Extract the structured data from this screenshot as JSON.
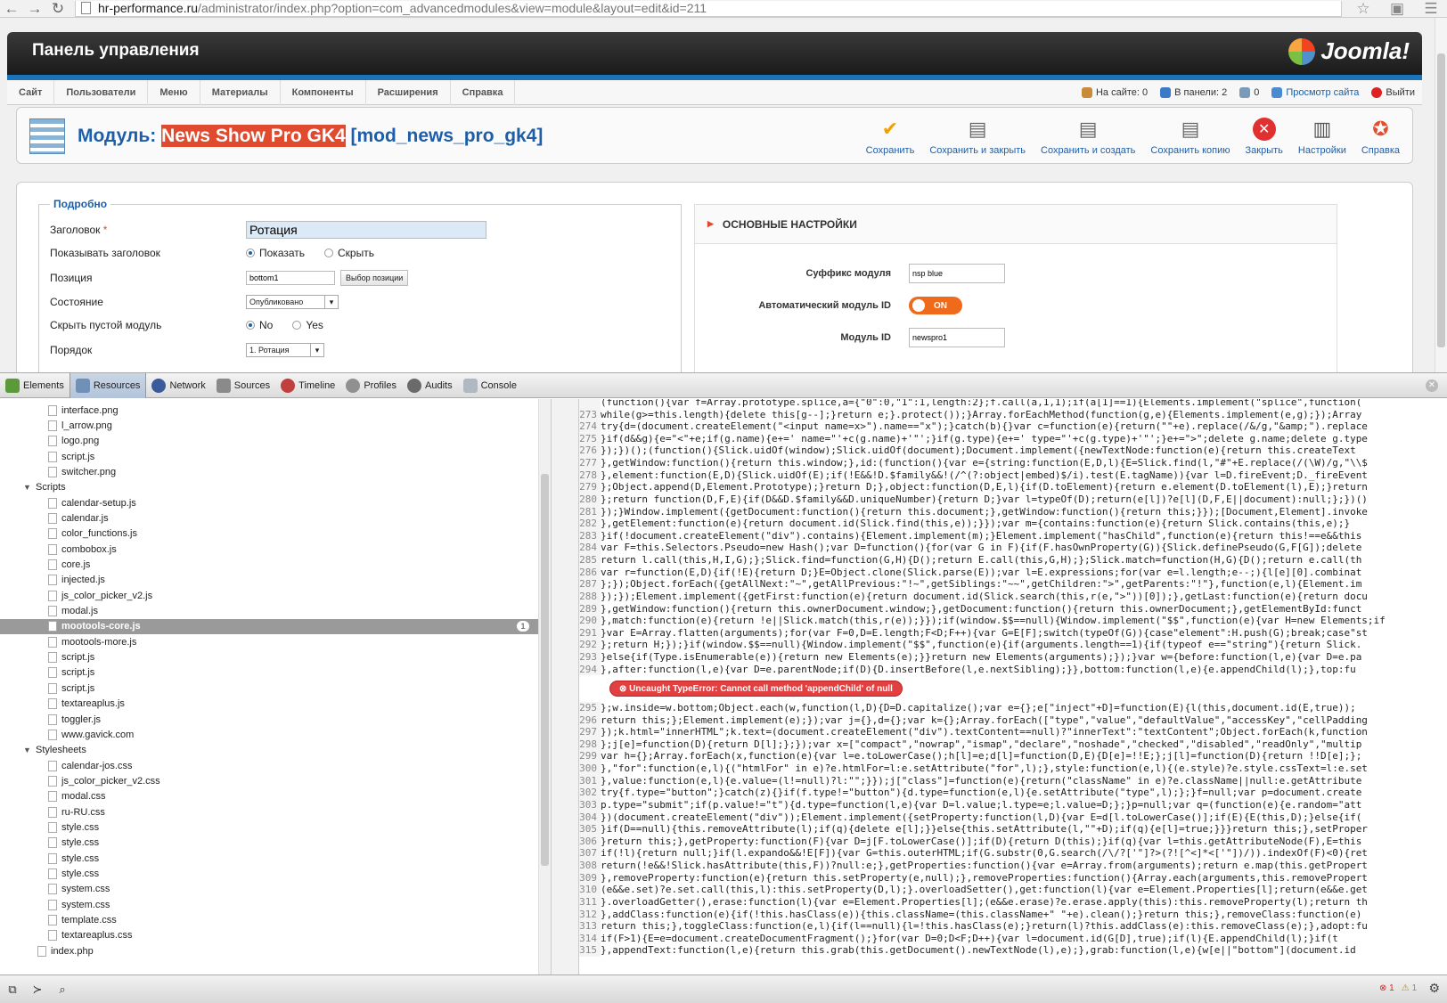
{
  "browser": {
    "url_host": "hr-performance.ru",
    "url_path": "/administrator/index.php?option=com_advancedmodules&view=module&layout=edit&id=211"
  },
  "header": {
    "title": "Панель управления",
    "logo_text": "Joomla!"
  },
  "menu": [
    "Сайт",
    "Пользователи",
    "Меню",
    "Материалы",
    "Компоненты",
    "Расширения",
    "Справка"
  ],
  "status": {
    "online": "На сайте: 0",
    "admins": "В панели: 2",
    "messages": "0",
    "view_site": "Просмотр сайта",
    "logout": "Выйти"
  },
  "page_title": {
    "prefix": "Модуль: ",
    "name": "News Show Pro GK4",
    "suffix": " [mod_news_pro_gk4]"
  },
  "toolbar": [
    "Сохранить",
    "Сохранить и закрыть",
    "Сохранить и создать",
    "Сохранить копию",
    "Закрыть",
    "Настройки",
    "Справка"
  ],
  "form": {
    "legend": "Подробно",
    "title_label": "Заголовок",
    "title_required": "*",
    "title_value": "Ротация",
    "show_title_label": "Показывать заголовок",
    "show": "Показать",
    "hide": "Скрыть",
    "position_label": "Позиция",
    "position_value": "bottom1",
    "position_btn": "Выбор позиции",
    "state_label": "Состояние",
    "state_value": "Опубликовано",
    "hide_empty_label": "Скрыть пустой модуль",
    "no": "No",
    "yes": "Yes",
    "order_label": "Порядок",
    "order_value": "1. Ротация"
  },
  "right": {
    "section": "ОСНОВНЫЕ НАСТРОЙКИ",
    "suffix_label": "Суффикс модуля",
    "suffix_value": "nsp blue",
    "auto_id_label": "Автоматический модуль ID",
    "toggle": "ON",
    "modid_label": "Модуль ID",
    "modid_value": "newspro1"
  },
  "devtools": {
    "tabs": [
      "Elements",
      "Resources",
      "Network",
      "Sources",
      "Timeline",
      "Profiles",
      "Audits",
      "Console"
    ],
    "tree": [
      {
        "t": "file",
        "n": "interface.png",
        "d": 1
      },
      {
        "t": "file",
        "n": "l_arrow.png",
        "d": 1
      },
      {
        "t": "file",
        "n": "logo.png",
        "d": 1
      },
      {
        "t": "file",
        "n": "script.js",
        "d": 1
      },
      {
        "t": "file",
        "n": "switcher.png",
        "d": 1
      },
      {
        "t": "folder",
        "n": "Scripts",
        "d": 0
      },
      {
        "t": "file",
        "n": "calendar-setup.js",
        "d": 1
      },
      {
        "t": "file",
        "n": "calendar.js",
        "d": 1
      },
      {
        "t": "file",
        "n": "color_functions.js",
        "d": 1
      },
      {
        "t": "file",
        "n": "combobox.js",
        "d": 1
      },
      {
        "t": "file",
        "n": "core.js",
        "d": 1
      },
      {
        "t": "file",
        "n": "injected.js",
        "d": 1
      },
      {
        "t": "file",
        "n": "js_color_picker_v2.js",
        "d": 1
      },
      {
        "t": "file",
        "n": "modal.js",
        "d": 1
      },
      {
        "t": "file",
        "n": "mootools-core.js",
        "d": 1,
        "sel": true,
        "badge": "1"
      },
      {
        "t": "file",
        "n": "mootools-more.js",
        "d": 1
      },
      {
        "t": "file",
        "n": "script.js",
        "d": 1
      },
      {
        "t": "file",
        "n": "script.js",
        "d": 1
      },
      {
        "t": "file",
        "n": "script.js",
        "d": 1
      },
      {
        "t": "file",
        "n": "textareaplus.js",
        "d": 1
      },
      {
        "t": "file",
        "n": "toggler.js",
        "d": 1
      },
      {
        "t": "file",
        "n": "www.gavick.com",
        "d": 1
      },
      {
        "t": "folder",
        "n": "Stylesheets",
        "d": 0
      },
      {
        "t": "file",
        "n": "calendar-jos.css",
        "d": 1
      },
      {
        "t": "file",
        "n": "js_color_picker_v2.css",
        "d": 1
      },
      {
        "t": "file",
        "n": "modal.css",
        "d": 1
      },
      {
        "t": "file",
        "n": "ru-RU.css",
        "d": 1
      },
      {
        "t": "file",
        "n": "style.css",
        "d": 1
      },
      {
        "t": "file",
        "n": "style.css",
        "d": 1
      },
      {
        "t": "file",
        "n": "style.css",
        "d": 1
      },
      {
        "t": "file",
        "n": "style.css",
        "d": 1
      },
      {
        "t": "file",
        "n": "system.css",
        "d": 1
      },
      {
        "t": "file",
        "n": "system.css",
        "d": 1
      },
      {
        "t": "file",
        "n": "template.css",
        "d": 1
      },
      {
        "t": "file",
        "n": "textareaplus.css",
        "d": 1
      },
      {
        "t": "file",
        "n": "index.php",
        "d": 0
      }
    ],
    "error": "Uncaught TypeError: Cannot call method 'appendChild' of null",
    "code_top": [
      [
        "",
        "(function(){var f=Array.prototype.splice,a={\"0\":0,\"1\":1,length:2};f.call(a,1,1);if(a[1]==1){Elements.implement(\"splice\",function("
      ],
      [
        "273",
        "while(g>=this.length){delete this[g--];}return e;}.protect());}Array.forEachMethod(function(g,e){Elements.implement(e,g);});Array"
      ],
      [
        "274",
        "try{d=(document.createElement(\"<input name=x>\").name==\"x\");}catch(b){}var c=function(e){return(\"\"+e).replace(/&/g,\"&amp;\").replace"
      ],
      [
        "275",
        "}if(d&&g){e=\"<\"+e;if(g.name){e+=' name=\"'+c(g.name)+'\"';}if(g.type){e+=' type=\"'+c(g.type)+'\"';}e+=\">\";delete g.name;delete g.type"
      ],
      [
        "276",
        "});})();(function(){Slick.uidOf(window);Slick.uidOf(document);Document.implement({newTextNode:function(e){return this.createText"
      ],
      [
        "277",
        "},getWindow:function(){return this.window;},id:(function(){var e={string:function(E,D,l){E=Slick.find(l,\"#\"+E.replace(/(\\W)/g,\"\\\\$"
      ],
      [
        "278",
        "},element:function(E,D){Slick.uidOf(E);if(!E&&!D.$family&&!(/^(?:object|embed)$/i).test(E.tagName)){var l=D.fireEvent;D._fireEvent"
      ],
      [
        "279",
        "};Object.append(D,Element.Prototype);}return D;},object:function(D,E,l){if(D.toElement){return e.element(D.toElement(l),E);}return"
      ],
      [
        "280",
        "};return function(D,F,E){if(D&&D.$family&&D.uniqueNumber){return D;}var l=typeOf(D);return(e[l])?e[l](D,F,E||document):null;};})()"
      ],
      [
        "281",
        "});}Window.implement({getDocument:function(){return this.document;},getWindow:function(){return this;}});[Document,Element].invoke"
      ],
      [
        "282",
        "},getElement:function(e){return document.id(Slick.find(this,e));}});var m={contains:function(e){return Slick.contains(this,e);}"
      ],
      [
        "283",
        "}if(!document.createElement(\"div\").contains){Element.implement(m);}Element.implement(\"hasChild\",function(e){return this!==e&&this"
      ],
      [
        "284",
        "var F=this.Selectors.Pseudo=new Hash();var D=function(){for(var G in F){if(F.hasOwnProperty(G)){Slick.definePseudo(G,F[G]);delete"
      ],
      [
        "285",
        "return l.call(this,H,I,G);};Slick.find=function(G,H){D();return E.call(this,G,H);};Slick.match=function(H,G){D();return e.call(th"
      ],
      [
        "286",
        "var r=function(E,D){if(!E){return D;}E=Object.clone(Slick.parse(E));var l=E.expressions;for(var e=l.length;e--;){l[e][0].combinat"
      ],
      [
        "287",
        "};});Object.forEach({getAllNext:\"~\",getAllPrevious:\"!~\",getSiblings:\"~~\",getChildren:\">\",getParents:\"!\"},function(e,l){Element.im"
      ],
      [
        "288",
        "});});Element.implement({getFirst:function(e){return document.id(Slick.search(this,r(e,\">\"))[0]);},getLast:function(e){return docu"
      ],
      [
        "289",
        "},getWindow:function(){return this.ownerDocument.window;},getDocument:function(){return this.ownerDocument;},getElementById:funct"
      ],
      [
        "290",
        "},match:function(e){return !e||Slick.match(this,r(e));}});if(window.$$==null){Window.implement(\"$$\",function(e){var H=new Elements;if"
      ],
      [
        "291",
        "}var E=Array.flatten(arguments);for(var F=0,D=E.length;F<D;F++){var G=E[F];switch(typeOf(G)){case\"element\":H.push(G);break;case\"st"
      ],
      [
        "292",
        "};return H;});}if(window.$$==null){Window.implement(\"$$\",function(e){if(arguments.length==1){if(typeof e==\"string\"){return Slick."
      ],
      [
        "293",
        "}else{if(Type.isEnumerable(e)){return new Elements(e);}}return new Elements(arguments);});}var w={before:function(l,e){var D=e.pa"
      ],
      [
        "294",
        "},after:function(l,e){var D=e.parentNode;if(D){D.insertBefore(l,e.nextSibling);}},bottom:function(l,e){e.appendChild(l);},top:fu"
      ]
    ],
    "code_bottom": [
      [
        "295",
        "};w.inside=w.bottom;Object.each(w,function(l,D){D=D.capitalize();var e={};e[\"inject\"+D]=function(E){l(this,document.id(E,true));"
      ],
      [
        "296",
        "return this;};Element.implement(e);});var j={},d={};var k={};Array.forEach([\"type\",\"value\",\"defaultValue\",\"accessKey\",\"cellPadding"
      ],
      [
        "297",
        "});k.html=\"innerHTML\";k.text=(document.createElement(\"div\").textContent==null)?\"innerText\":\"textContent\";Object.forEach(k,function"
      ],
      [
        "298",
        "};j[e]=function(D){return D[l];};});var x=[\"compact\",\"nowrap\",\"ismap\",\"declare\",\"noshade\",\"checked\",\"disabled\",\"readOnly\",\"multip"
      ],
      [
        "299",
        "var h={};Array.forEach(x,function(e){var l=e.toLowerCase();h[l]=e;d[l]=function(D,E){D[e]=!!E;};j[l]=function(D){return !!D[e];};"
      ],
      [
        "300",
        "},\"for\":function(e,l){(\"htmlFor\" in e)?e.htmlFor=l:e.setAttribute(\"for\",l);},style:function(e,l){(e.style)?e.style.cssText=l:e.set"
      ],
      [
        "301",
        "},value:function(e,l){e.value=(l!=null)?l:\"\";}});j[\"class\"]=function(e){return(\"className\" in e)?e.className||null:e.getAttribute"
      ],
      [
        "302",
        "try{f.type=\"button\";}catch(z){}if(f.type!=\"button\"){d.type=function(e,l){e.setAttribute(\"type\",l);};}f=null;var p=document.create"
      ],
      [
        "303",
        "p.type=\"submit\";if(p.value!=\"t\"){d.type=function(l,e){var D=l.value;l.type=e;l.value=D;};}p=null;var q=(function(e){e.random=\"att"
      ],
      [
        "304",
        "})(document.createElement(\"div\"));Element.implement({setProperty:function(l,D){var E=d[l.toLowerCase()];if(E){E(this,D);}else{if("
      ],
      [
        "305",
        "}if(D==null){this.removeAttribute(l);if(q){delete e[l];}}else{this.setAttribute(l,\"\"+D);if(q){e[l]=true;}}}return this;},setProper"
      ],
      [
        "306",
        "}return this;},getProperty:function(F){var D=j[F.toLowerCase()];if(D){return D(this);}if(q){var l=this.getAttributeNode(F),E=this"
      ],
      [
        "307",
        "if(!l){return null;}if(l.expando&&!E[F]){var G=this.outerHTML;if(G.substr(0,G.search(/\\/?['\"]?>(?![^<]*<['\"])/)).indexOf(F)<0){ret"
      ],
      [
        "308",
        "return(!e&&!Slick.hasAttribute(this,F))?null:e;},getProperties:function(){var e=Array.from(arguments);return e.map(this.getPropert"
      ],
      [
        "309",
        "},removeProperty:function(e){return this.setProperty(e,null);},removeProperties:function(){Array.each(arguments,this.removePropert"
      ],
      [
        "310",
        "(e&&e.set)?e.set.call(this,l):this.setProperty(D,l);}.overloadSetter(),get:function(l){var e=Element.Properties[l];return(e&&e.get"
      ],
      [
        "311",
        "}.overloadGetter(),erase:function(l){var e=Element.Properties[l];(e&&e.erase)?e.erase.apply(this):this.removeProperty(l);return th"
      ],
      [
        "312",
        "},addClass:function(e){if(!this.hasClass(e)){this.className=(this.className+\" \"+e).clean();}return this;},removeClass:function(e)"
      ],
      [
        "313",
        "return this;},toggleClass:function(e,l){if(l==null){l=!this.hasClass(e);}return(l)?this.addClass(e):this.removeClass(e);},adopt:fu"
      ],
      [
        "314",
        "if(F>1){E=e=document.createDocumentFragment();}for(var D=0;D<F;D++){var l=document.id(G[D],true);if(l){E.appendChild(l);}if(t"
      ],
      [
        "315",
        "},appendText:function(l,e){return this.grab(this.getDocument().newTextNode(l),e);},grab:function(l,e){w[e||\"bottom\"](document.id"
      ]
    ],
    "counts": {
      "errors": "1",
      "warnings": "1"
    }
  }
}
